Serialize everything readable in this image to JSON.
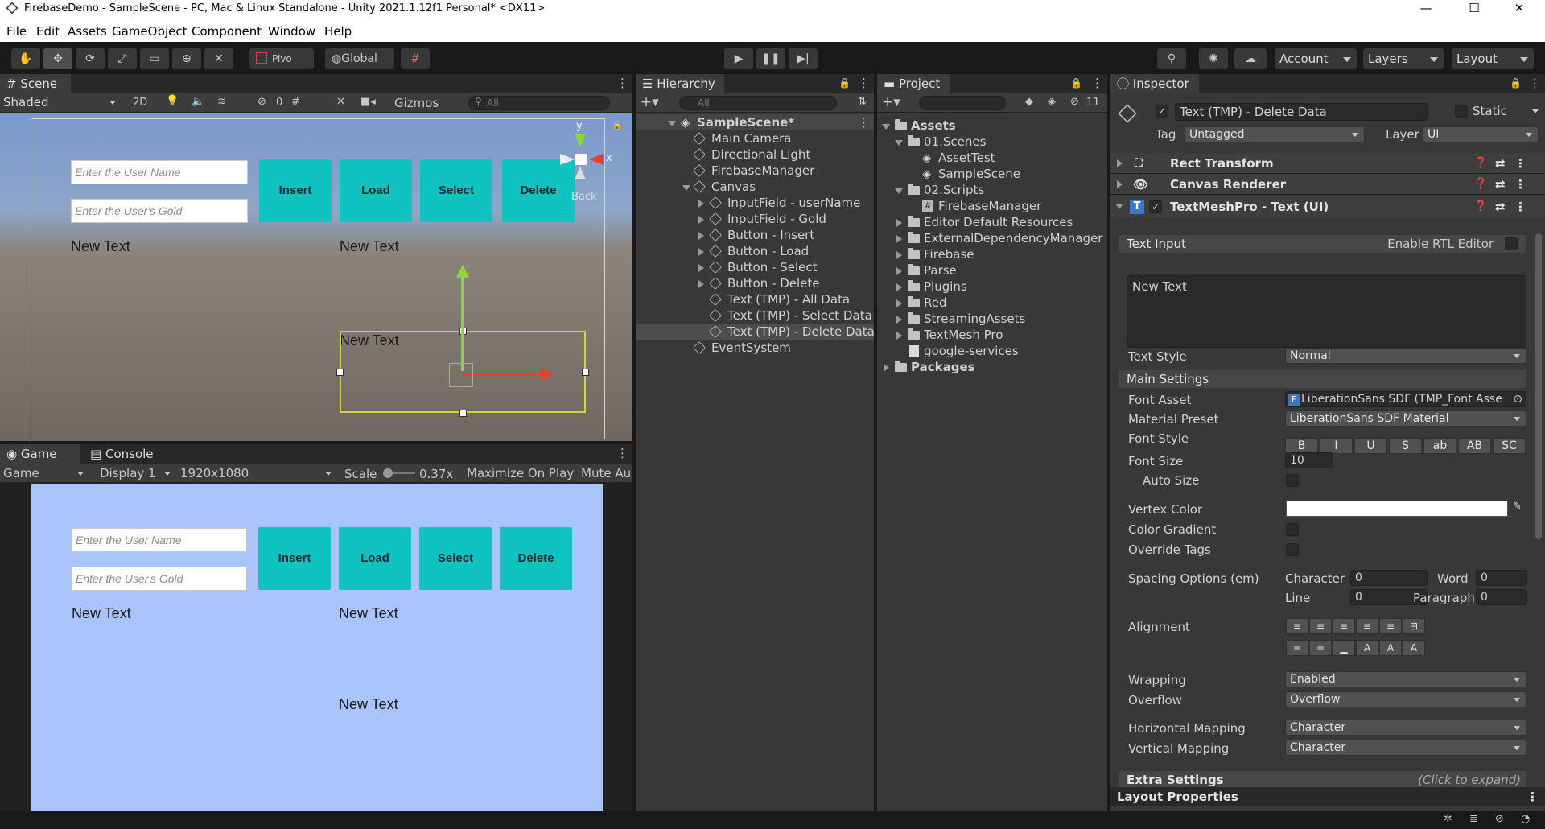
{
  "window": {
    "title": "FirebaseDemo - SampleScene - PC, Mac & Linux Standalone - Unity 2021.1.12f1 Personal* <DX11>"
  },
  "menu": [
    "File",
    "Edit",
    "Assets",
    "GameObject",
    "Component",
    "Window",
    "Help"
  ],
  "toolbar": {
    "pivot": "Pivo",
    "global": "Global",
    "account": "Account",
    "layers": "Layers",
    "layout": "Layout"
  },
  "scene": {
    "tab": "Scene",
    "shading": "Shaded",
    "mode2d": "2D",
    "hidden_count": "0",
    "gizmos": "Gizmos",
    "search_placeholder": "All",
    "inputs": [
      "Enter the User Name",
      "Enter the User's Gold"
    ],
    "buttons": [
      "Insert",
      "Load",
      "Select",
      "Delete"
    ],
    "texts": [
      "New Text",
      "New Text",
      "New Text"
    ],
    "gizmo_axes": {
      "y": "y",
      "x": "x"
    },
    "back_label": "Back"
  },
  "game": {
    "tabs": [
      "Game",
      "Console"
    ],
    "mode": "Game",
    "display": "Display 1",
    "resolution": "1920x1080",
    "scale_label": "Scale",
    "scale_value": "0.37x",
    "maximize": "Maximize On Play",
    "mute": "Mute Auc",
    "inputs": [
      "Enter the User Name",
      "Enter the User's Gold"
    ],
    "buttons": [
      "Insert",
      "Load",
      "Select",
      "Delete"
    ],
    "texts": [
      "New Text",
      "New Text",
      "New Text"
    ]
  },
  "hierarchy": {
    "tab": "Hierarchy",
    "search_placeholder": "All",
    "items": [
      {
        "label": "SampleScene*"
      },
      {
        "label": "Main Camera"
      },
      {
        "label": "Directional Light"
      },
      {
        "label": "FirebaseManager"
      },
      {
        "label": "Canvas"
      },
      {
        "label": "InputField - userName"
      },
      {
        "label": "InputField - Gold"
      },
      {
        "label": "Button - Insert"
      },
      {
        "label": "Button - Load"
      },
      {
        "label": "Button - Select"
      },
      {
        "label": "Button - Delete"
      },
      {
        "label": "Text (TMP) - All Data"
      },
      {
        "label": "Text (TMP) - Select Data"
      },
      {
        "label": "Text (TMP) - Delete Data"
      },
      {
        "label": "EventSystem"
      }
    ]
  },
  "project": {
    "tab": "Project",
    "hidden_count": "11",
    "items": [
      {
        "label": "Assets"
      },
      {
        "label": "01.Scenes"
      },
      {
        "label": "AssetTest"
      },
      {
        "label": "SampleScene"
      },
      {
        "label": "02.Scripts"
      },
      {
        "label": "FirebaseManager"
      },
      {
        "label": "Editor Default Resources"
      },
      {
        "label": "ExternalDependencyManager"
      },
      {
        "label": "Firebase"
      },
      {
        "label": "Parse"
      },
      {
        "label": "Plugins"
      },
      {
        "label": "Red"
      },
      {
        "label": "StreamingAssets"
      },
      {
        "label": "TextMesh Pro"
      },
      {
        "label": "google-services"
      },
      {
        "label": "Packages"
      }
    ]
  },
  "inspector": {
    "tab": "Inspector",
    "object_name": "Text (TMP) - Delete Data",
    "static_label": "Static",
    "tag_label": "Tag",
    "tag_value": "Untagged",
    "layer_label": "Layer",
    "layer_value": "UI",
    "components": [
      "Rect Transform",
      "Canvas Renderer",
      "TextMeshPro - Text (UI)"
    ],
    "text_input_label": "Text Input",
    "rtl_label": "Enable RTL Editor",
    "text_value": "New Text",
    "text_style_label": "Text Style",
    "text_style_value": "Normal",
    "main_settings": "Main Settings",
    "font_asset_label": "Font Asset",
    "font_asset_value": "LiberationSans SDF (TMP_Font Asse",
    "material_label": "Material Preset",
    "material_value": "LiberationSans SDF Material",
    "font_style_label": "Font Style",
    "font_styles": [
      "B",
      "I",
      "U",
      "S",
      "ab",
      "AB",
      "SC"
    ],
    "font_size_label": "Font Size",
    "font_size_value": "10",
    "auto_size_label": "Auto Size",
    "vertex_color_label": "Vertex Color",
    "color_gradient_label": "Color Gradient",
    "override_tags_label": "Override Tags",
    "spacing_label": "Spacing Options (em)",
    "spacing": {
      "character_label": "Character",
      "character": "0",
      "word_label": "Word",
      "word": "0",
      "line_label": "Line",
      "line": "0",
      "paragraph_label": "Paragraph",
      "paragraph": "0"
    },
    "alignment_label": "Alignment",
    "wrapping_label": "Wrapping",
    "wrapping_value": "Enabled",
    "overflow_label": "Overflow",
    "overflow_value": "Overflow",
    "hmap_label": "Horizontal Mapping",
    "hmap_value": "Character",
    "vmap_label": "Vertical Mapping",
    "vmap_value": "Character",
    "extra_settings": "Extra Settings",
    "extra_hint": "(Click to expand)",
    "layout_properties": "Layout Properties"
  },
  "colors": {
    "teal_button": "#10c3c0",
    "game_bg": "#a8c4f8",
    "editor_bg": "#383838"
  }
}
